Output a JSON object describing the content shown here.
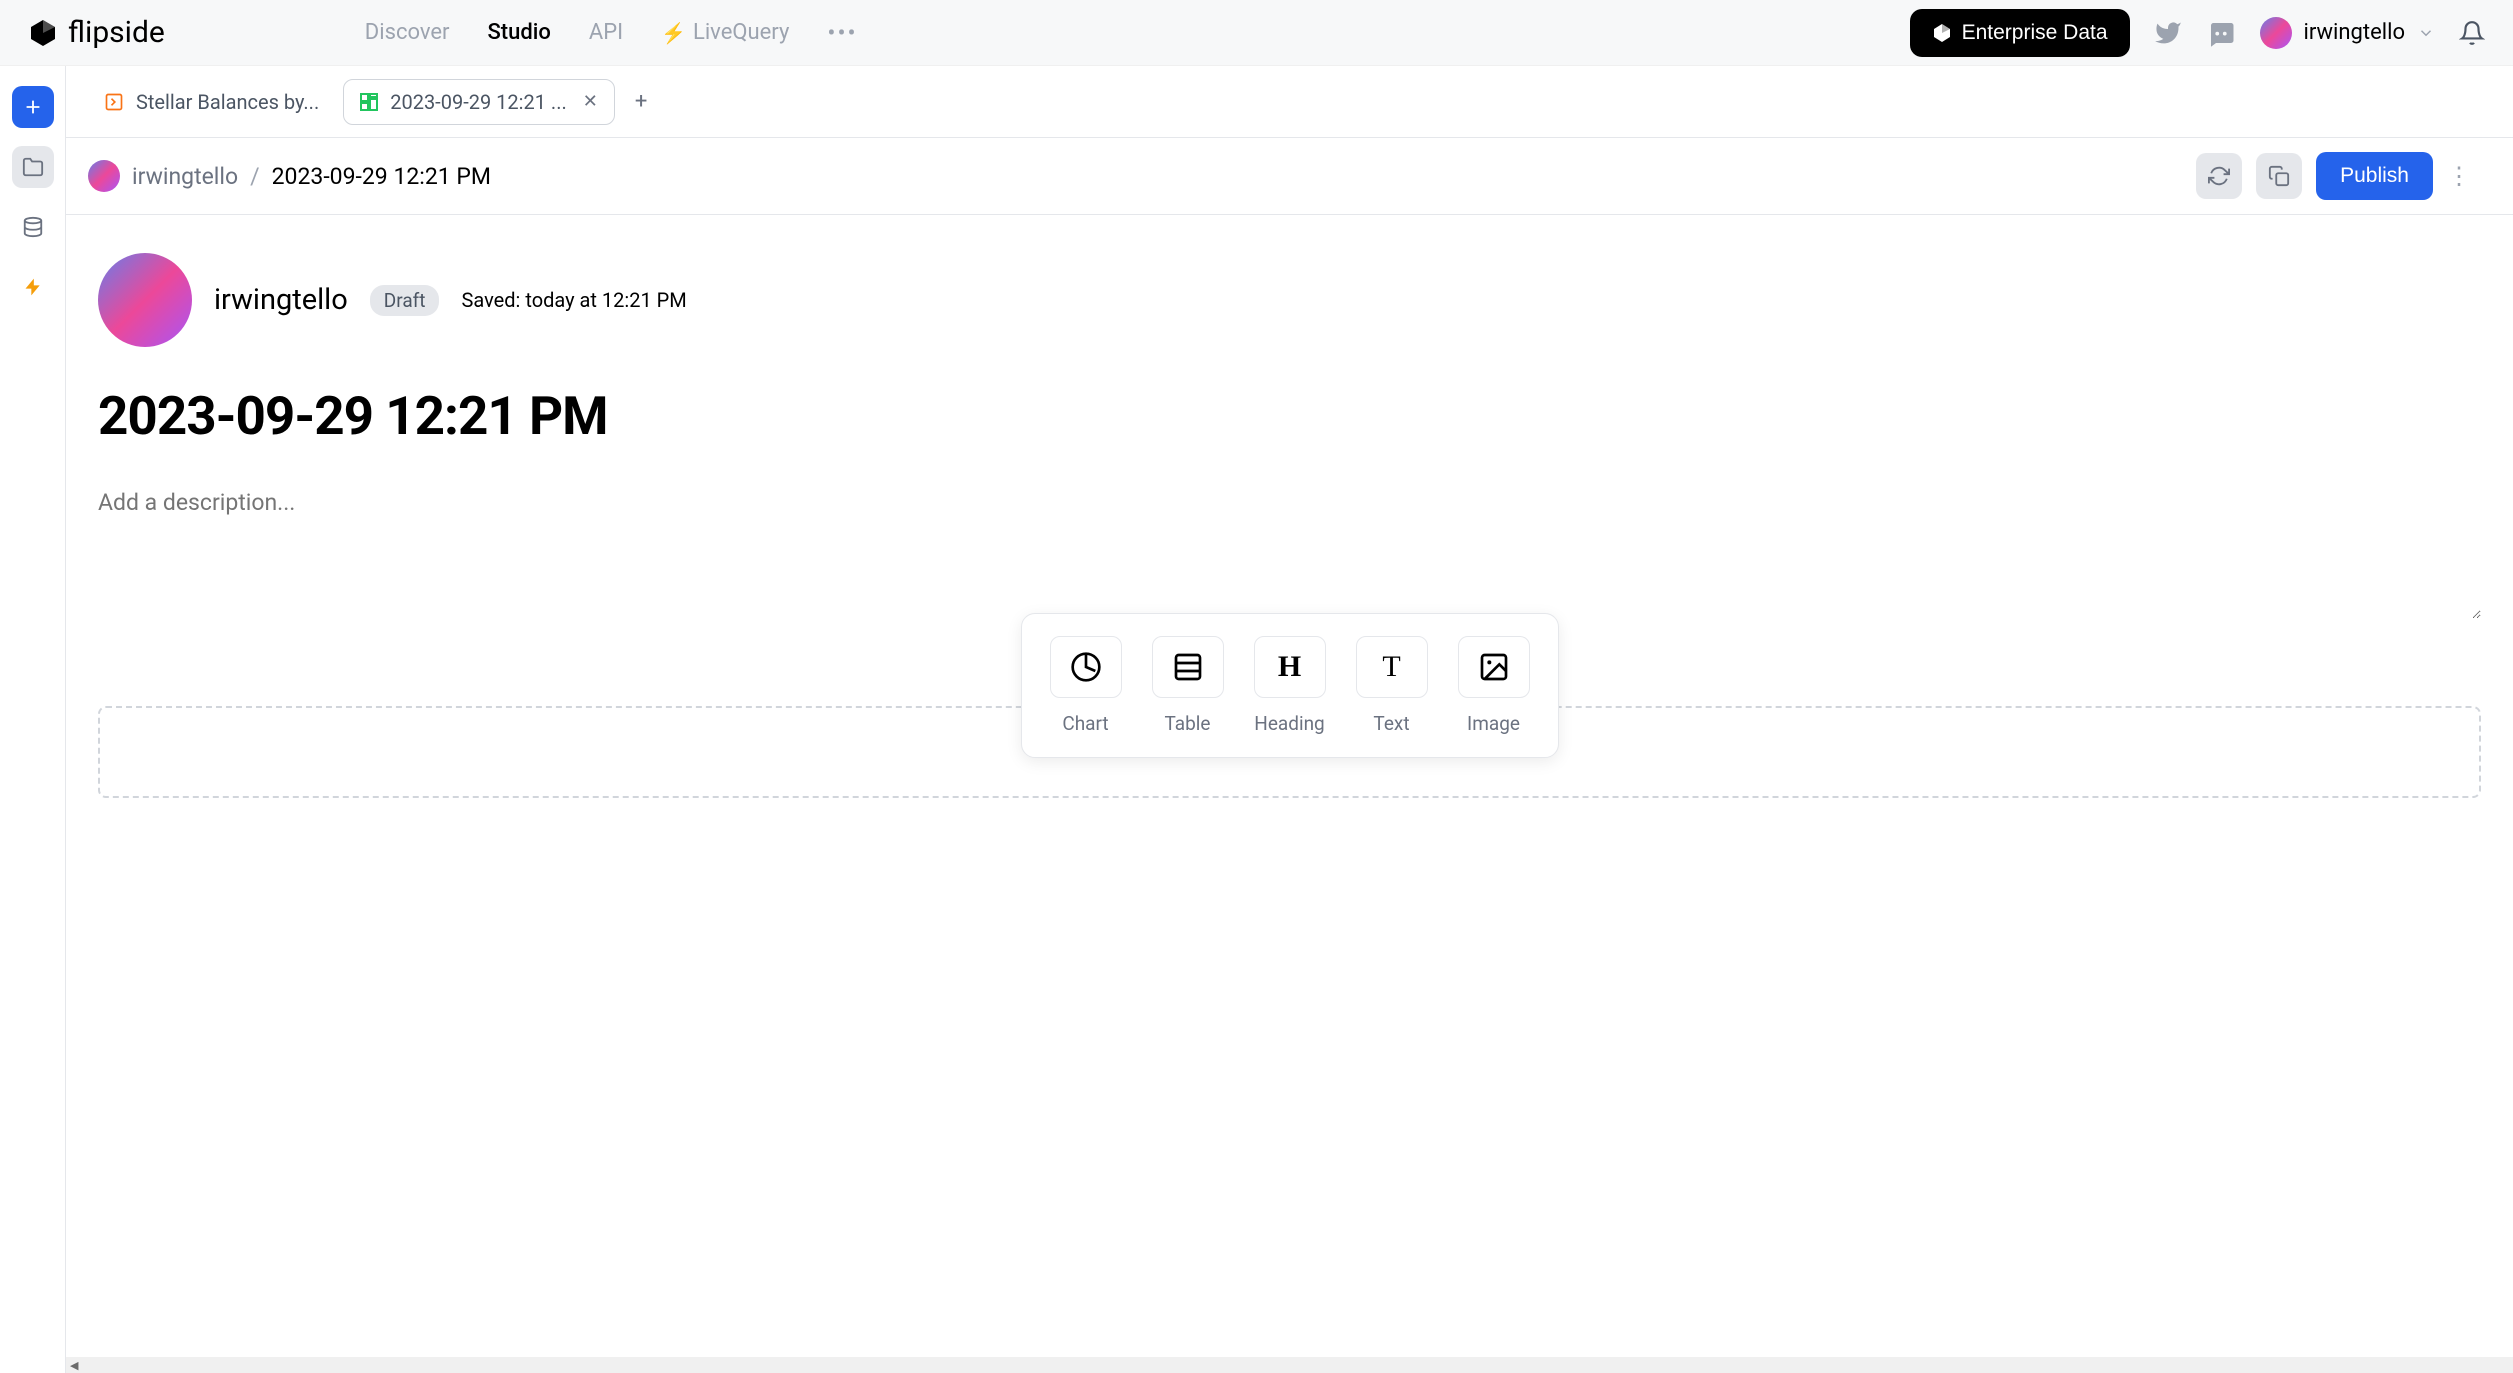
{
  "header": {
    "logo": "flipside",
    "nav": {
      "discover": "Discover",
      "studio": "Studio",
      "api": "API",
      "livequery": "LiveQuery"
    },
    "enterprise": "Enterprise Data",
    "username": "irwingtello"
  },
  "tabs": {
    "tab1": "Stellar Balances by...",
    "tab2": "2023-09-29 12:21 ..."
  },
  "breadcrumb": {
    "user": "irwingtello",
    "title": "2023-09-29 12:21 PM",
    "publish": "Publish"
  },
  "doc": {
    "author": "irwingtello",
    "draft": "Draft",
    "saved": "Saved: today at 12:21 PM",
    "title": "2023-09-29 12:21 PM",
    "desc_placeholder": "Add a description..."
  },
  "toolbar": {
    "chart": "Chart",
    "table": "Table",
    "heading": "Heading",
    "text": "Text",
    "image": "Image"
  }
}
